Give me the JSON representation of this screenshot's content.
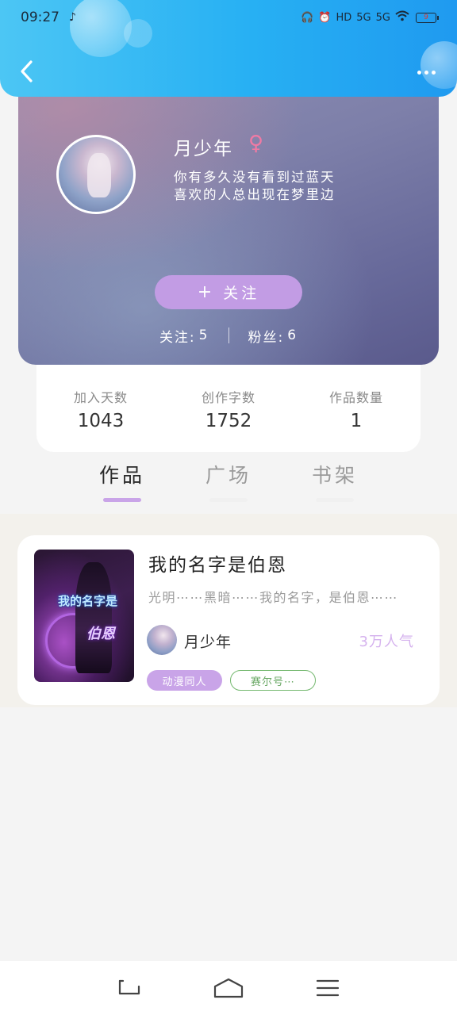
{
  "status_bar": {
    "time": "09:27",
    "battery": "9",
    "signal_label": "5G"
  },
  "profile": {
    "name": "月少年",
    "gender_symbol": "♀",
    "bio_line1": "你有多久没有看到过蓝天",
    "bio_line2": "喜欢的人总出现在梦里边",
    "follow_plus": "+",
    "follow_label": "关注",
    "following_label": "关注:",
    "following_value": "5",
    "fans_label": "粉丝:",
    "fans_value": "6"
  },
  "stats": [
    {
      "label": "加入天数",
      "value": "1043"
    },
    {
      "label": "创作字数",
      "value": "1752"
    },
    {
      "label": "作品数量",
      "value": "1"
    }
  ],
  "tabs": [
    {
      "label": "作品",
      "active": true
    },
    {
      "label": "广场",
      "active": false
    },
    {
      "label": "书架",
      "active": false
    }
  ],
  "work": {
    "cover_text1": "我的名字是",
    "cover_text2": "伯恩",
    "title": "我的名字是伯恩",
    "description": "光明⋯⋯黑暗⋯⋯我的名字，是伯恩⋯⋯",
    "author": "月少年",
    "popularity": "3万人气",
    "tag1": "动漫同人",
    "tag2": "赛尔号⋯"
  },
  "colors": {
    "header_blue": "#27b0f3",
    "accent_purple": "#c9a4e8",
    "tag_green": "#74b86f",
    "gender_pink": "#f07aa4"
  }
}
